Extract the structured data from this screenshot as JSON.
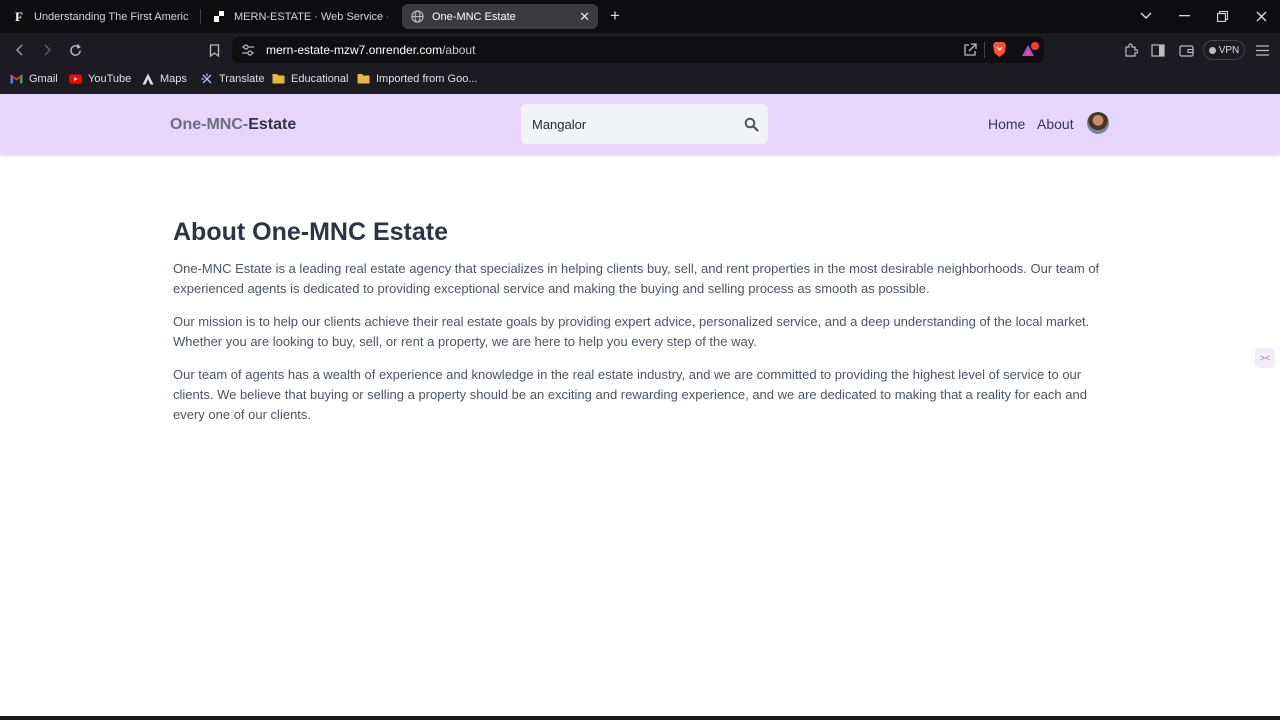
{
  "browser": {
    "tabs": [
      {
        "title": "Understanding The First American Fi",
        "favicon": "F",
        "active": false
      },
      {
        "title": "MERN-ESTATE · Web Service · Rend",
        "favicon": "render-icon",
        "active": false
      },
      {
        "title": "One-MNC Estate",
        "favicon": "globe-icon",
        "active": true
      }
    ],
    "url_host": "mern-estate-mzw7.onrender.com",
    "url_path": "/about",
    "vpn_label": "VPN",
    "bookmarks": [
      {
        "label": "Gmail",
        "icon": "gmail-icon"
      },
      {
        "label": "YouTube",
        "icon": "youtube-icon"
      },
      {
        "label": "Maps",
        "icon": "maps-icon"
      },
      {
        "label": "Translate",
        "icon": "translate-icon"
      },
      {
        "label": "Educational",
        "icon": "folder-icon"
      },
      {
        "label": "Imported from Goo...",
        "icon": "folder-icon"
      }
    ],
    "colors": {
      "accent_brave": "#fb542b",
      "folder": "#e8b63c"
    }
  },
  "site": {
    "logo_part1": "One-MNC-",
    "logo_part2": "Estate",
    "search_value": "Mangalor",
    "nav": [
      "Home",
      "About"
    ],
    "header_color": "#e6d6fc"
  },
  "about": {
    "heading": "About One-MNC Estate",
    "paragraphs": [
      "One-MNC Estate is a leading real estate agency that specializes in helping clients buy, sell, and rent properties in the most desirable neighborhoods. Our team of experienced agents is dedicated to providing exceptional service and making the buying and selling process as smooth as possible.",
      "Our mission is to help our clients achieve their real estate goals by providing expert advice, personalized service, and a deep understanding of the local market. Whether you are looking to buy, sell, or rent a property, we are here to help you every step of the way.",
      "Our team of agents has a wealth of experience and knowledge in the real estate industry, and we are committed to providing the highest level of service to our clients. We believe that buying or selling a property should be an exciting and rewarding experience, and we are dedicated to making that a reality for each and every one of our clients."
    ]
  }
}
